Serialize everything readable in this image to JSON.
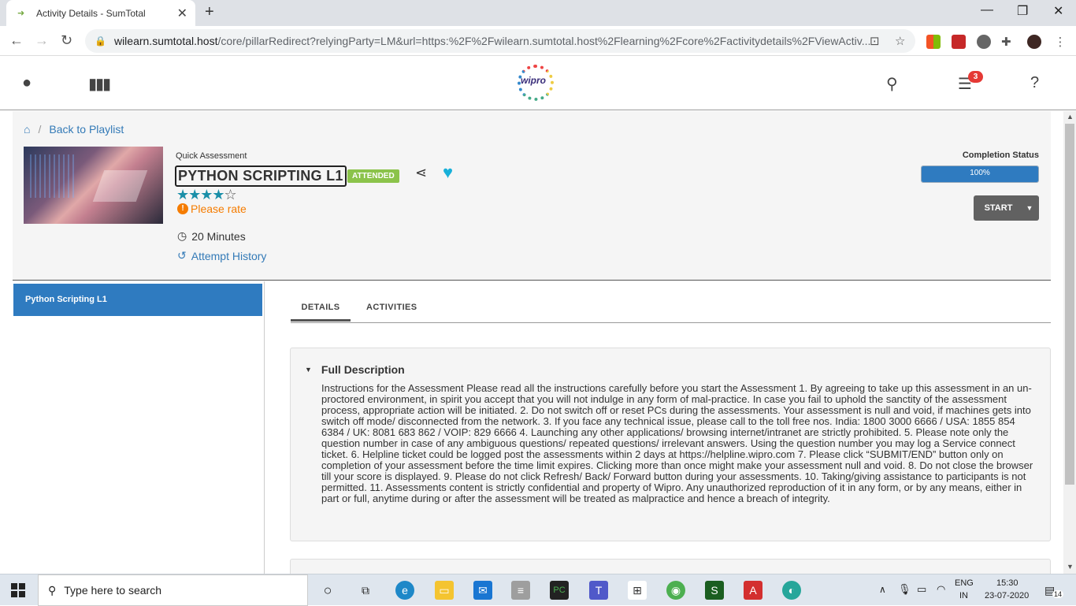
{
  "browser": {
    "tab_title": "Activity Details - SumTotal",
    "url_host": "wilearn.sumtotal.host",
    "url_rest": "/core/pillarRedirect?relyingParty=LM&url=https:%2F%2Fwilearn.sumtotal.host%2Flearning%2Fcore%2Factivitydetails%2FViewActiv..."
  },
  "header": {
    "logo_text": "wipro",
    "notification_count": "3"
  },
  "breadcrumb": {
    "back_label": "Back to Playlist"
  },
  "activity": {
    "type_label": "Quick Assessment",
    "title": "PYTHON SCRIPTING L1",
    "status_badge": "ATTENDED",
    "rating_filled": "★★★★",
    "rating_empty": "☆",
    "please_rate": "Please rate",
    "duration": "20 Minutes",
    "attempt_history": "Attempt History"
  },
  "completion": {
    "label": "Completion Status",
    "percent_text": "100%",
    "percent_value": 100,
    "start_label": "START"
  },
  "sidebar": {
    "items": [
      {
        "label": "Python Scripting L1"
      }
    ]
  },
  "tabs": [
    {
      "label": "DETAILS"
    },
    {
      "label": "ACTIVITIES"
    }
  ],
  "description": {
    "heading": "Full Description",
    "text": "Instructions for the Assessment Please read all the instructions carefully before you start the Assessment 1. By agreeing to take up this assessment in an un-proctored environment, in spirit you accept that you will not indulge in any form of mal-practice. In case you fail to uphold the sanctity of the assessment process, appropriate action will be initiated. 2. Do not switch off or reset PCs during the assessments. Your assessment is null and void, if machines gets into switch off mode/ disconnected from the network. 3. If you face any technical issue, please call to the toll free nos. India: 1800 3000 6666 / USA: 1855 854 6384 / UK: 8081 683 862 / VOIP: 829 6666 4. Launching any other applications/ browsing internet/intranet are strictly prohibited. 5. Please note only the question number in case of any ambiguous questions/ repeated questions/ irrelevant answers. Using the question number you may log a Service connect ticket. 6. Helpline ticket could be logged post the assessments within 2 days at https://helpline.wipro.com 7. Please click “SUBMIT/END” button only on completion of your assessment before the time limit expires. Clicking more than once might make your assessment null and void. 8. Do not close the browser till your score is displayed. 9. Please do not click Refresh/ Back/ Forward button during your assessments. 10. Taking/giving assistance to participants is not permitted. 11. Assessments content is strictly confidential and property of Wipro. Any unauthorized reproduction of it in any form, or by any means, either in part or full, anytime during or after the assessment will be treated as malpractice and hence a breach of integrity."
  },
  "taskbar": {
    "search_placeholder": "Type here to search",
    "lang_top": "ENG",
    "lang_bottom": "IN",
    "time": "15:30",
    "date": "23-07-2020",
    "notif_count": "14"
  }
}
